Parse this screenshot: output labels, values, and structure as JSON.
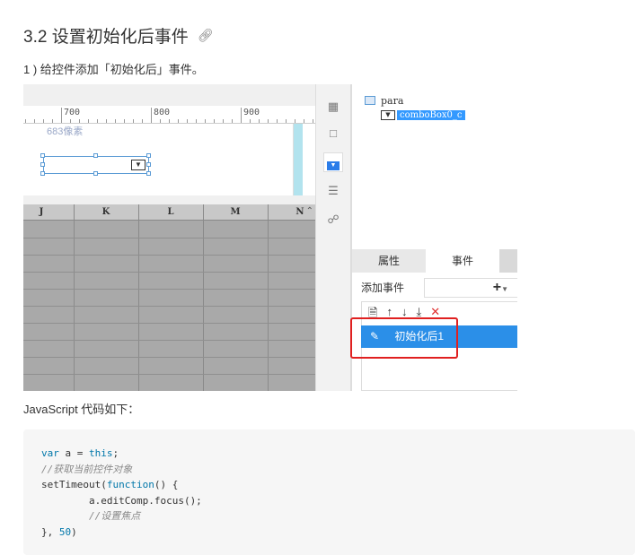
{
  "heading": {
    "title": "3.2 设置初始化后事件",
    "anchor_icon": "link-icon"
  },
  "step": "1 ) 给控件添加「初始化后」事件。",
  "screenshot": {
    "ruler": {
      "marks": [
        "700",
        "800",
        "900"
      ]
    },
    "pixel_label": "683像素",
    "grid_columns": [
      "J",
      "K",
      "L",
      "M",
      "N"
    ],
    "tools": [
      "cell-attr-icon",
      "border-icon",
      "widget-icon",
      "list-icon",
      "link-chain-icon"
    ],
    "tree": {
      "root": "para",
      "child": "comboBox0_c"
    },
    "tabs": {
      "props": "属性",
      "events": "事件"
    },
    "add_event_label": "添加事件",
    "add_button": "+",
    "event_item": "初始化后1",
    "highlight_color": "#e02020"
  },
  "caption": "JavaScript 代码如下：",
  "code": {
    "l1_kw1": "var",
    "l1_rest": " a = ",
    "l1_kw2": "this",
    "l1_end": ";",
    "l2": "//获取当前控件对象",
    "l3_fn": "setTimeout(",
    "l3_kw": "function",
    "l3_end": "() {",
    "l4": "        a.editComp.focus();",
    "l5": "        //设置焦点",
    "l6_start": "}, ",
    "l6_num": "50",
    "l6_end": ")"
  }
}
